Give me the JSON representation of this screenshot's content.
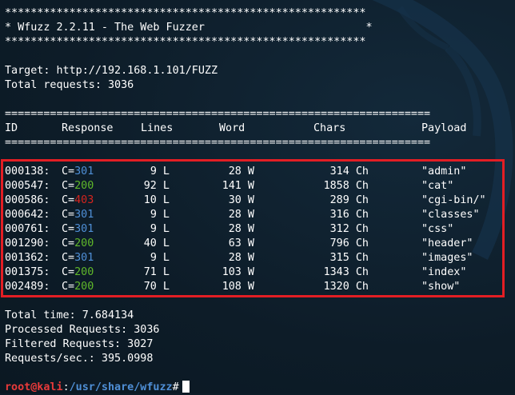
{
  "banner": {
    "border": "********************************************************",
    "title_line": "* Wfuzz 2.2.11 - The Web Fuzzer                         *"
  },
  "target_line": "Target: http://192.168.1.101/FUZZ",
  "total_requests_line": "Total requests: 3036",
  "separator": "==================================================================",
  "headers": {
    "id": "ID",
    "response": "Response",
    "lines": "Lines",
    "word": "Word",
    "chars": "Chars",
    "payload": "Payload"
  },
  "rows": [
    {
      "id": "000138:",
      "c_prefix": "C=",
      "code": "301",
      "code_color": "#4f8fd6",
      "lines": "9 L",
      "words": "28 W",
      "chars": "314 Ch",
      "payload": "\"admin\""
    },
    {
      "id": "000547:",
      "c_prefix": "C=",
      "code": "200",
      "code_color": "#5fb82a",
      "lines": "92 L",
      "words": "141 W",
      "chars": "1858 Ch",
      "payload": "\"cat\""
    },
    {
      "id": "000586:",
      "c_prefix": "C=",
      "code": "403",
      "code_color": "#d4241e",
      "lines": "10 L",
      "words": "30 W",
      "chars": "289 Ch",
      "payload": "\"cgi-bin/\""
    },
    {
      "id": "000642:",
      "c_prefix": "C=",
      "code": "301",
      "code_color": "#4f8fd6",
      "lines": "9 L",
      "words": "28 W",
      "chars": "316 Ch",
      "payload": "\"classes\""
    },
    {
      "id": "000761:",
      "c_prefix": "C=",
      "code": "301",
      "code_color": "#4f8fd6",
      "lines": "9 L",
      "words": "28 W",
      "chars": "312 Ch",
      "payload": "\"css\""
    },
    {
      "id": "001290:",
      "c_prefix": "C=",
      "code": "200",
      "code_color": "#5fb82a",
      "lines": "40 L",
      "words": "63 W",
      "chars": "796 Ch",
      "payload": "\"header\""
    },
    {
      "id": "001362:",
      "c_prefix": "C=",
      "code": "301",
      "code_color": "#4f8fd6",
      "lines": "9 L",
      "words": "28 W",
      "chars": "315 Ch",
      "payload": "\"images\""
    },
    {
      "id": "001375:",
      "c_prefix": "C=",
      "code": "200",
      "code_color": "#5fb82a",
      "lines": "71 L",
      "words": "103 W",
      "chars": "1343 Ch",
      "payload": "\"index\""
    },
    {
      "id": "002489:",
      "c_prefix": "C=",
      "code": "200",
      "code_color": "#5fb82a",
      "lines": "70 L",
      "words": "108 W",
      "chars": "1320 Ch",
      "payload": "\"show\""
    }
  ],
  "summary": {
    "total_time": "Total time: 7.684134",
    "processed": "Processed Requests: 3036",
    "filtered": "Filtered Requests: 3027",
    "rate": "Requests/sec.: 395.0998"
  },
  "prompt": {
    "user_host": "root@kali",
    "colon": ":",
    "path": "/usr/share/wfuzz",
    "symbol": "#"
  },
  "colors": {
    "background": "#0d1c28",
    "highlight_box": "#e31e24",
    "code_301": "#4f8fd6",
    "code_200": "#5fb82a",
    "code_403": "#d4241e"
  },
  "icons": {
    "watermark": "kali-dragon-watermark"
  }
}
